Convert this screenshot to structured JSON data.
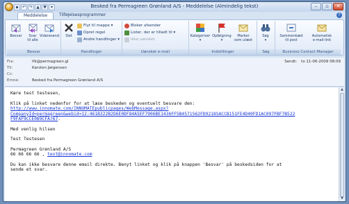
{
  "window": {
    "title": "Besked fra Permagreen Grønland A/S - Meddelelse (Almindelig tekst)",
    "minimize": "–",
    "maximize": "▫",
    "close": "✕"
  },
  "qat": {
    "save": "▪",
    "undo": "↶",
    "redo": "↷",
    "up": "▲",
    "down": "▼",
    "more": "▾"
  },
  "tabs": [
    {
      "label": "Meddelelse"
    },
    {
      "label": "Tilføjelsesprogrammer"
    }
  ],
  "ribbon": {
    "groups": [
      {
        "label": "Besvar",
        "buttons": [
          {
            "label": "Besvar"
          },
          {
            "label": "Svar\ntil alle"
          },
          {
            "label": "Videresend"
          }
        ]
      },
      {
        "label": "Handlinger",
        "big": {
          "label": "Slet"
        },
        "items": [
          {
            "label": "Flyt til mappe ▾"
          },
          {
            "label": "Opret regel"
          },
          {
            "label": "Andre handlinger ▾"
          }
        ]
      },
      {
        "label": "Uønsket e-mail",
        "items": [
          {
            "label": "Bloker afsender"
          },
          {
            "label": "Lister, der er tilladt til ▾"
          },
          {
            "label": "Ikke uønsket"
          }
        ]
      },
      {
        "label": "Indstillinger",
        "buttons": [
          {
            "label": "Kategoriser\n▾"
          },
          {
            "label": "Opfølgning\n▾"
          },
          {
            "label": "Marker\nsom ulæst"
          }
        ]
      },
      {
        "label": "Søg",
        "buttons": [
          {
            "label": "Søg\n▾"
          }
        ]
      },
      {
        "label": "Business Contact Manager",
        "buttons": [
          {
            "label": "Sammenkæd\ntil post"
          },
          {
            "label": "Automatisk\ne-mail-link"
          }
        ]
      }
    ]
  },
  "header": {
    "fields": [
      {
        "key": "Fra:",
        "value": "lfk@permagreen.gl"
      },
      {
        "key": "Til:",
        "value": "Karsten Jørgensen"
      },
      {
        "key": "Cc:",
        "value": ""
      },
      {
        "key": "Emne:",
        "value": "Besked fra Permagreen Grønland A/S"
      }
    ],
    "sent_label": "Sendt:",
    "sent_value": "to 11-06-2009 08:09"
  },
  "body": {
    "greeting": "Kære test testesen,",
    "intro": "Klik på linket nedenfor for at læse beskeden og eventuelt besvare den:",
    "link1": "http://www.innomate.com/INNOMATEpublicpages/WebMessage.aspx?",
    "link2": "CompanyId=permagreen&webid=12:461B322B2D6E0DF84A5EF7906BE1436FF5B4571562FD9218SACCB151FE4D40FD1AC097FBF7B522",
    "link3": "F9FAF9CCE0B9CFA767",
    "link3_tail": ".",
    "regards": "Med venlig hilsen",
    "name": "Test Testesen",
    "company": "Permagreen Grønland A/S",
    "phone": "66 66 66 66 , ",
    "email": "test@innomate.com",
    "note1": "Du kan ikke besvare denne email direkte. Benyt linket og klik på knappen 'Besvar' på beskedsiden for at",
    "note2": "sende et svar."
  },
  "colors": {
    "accent": "#1333d6",
    "titlebar": "#c4d6ee"
  }
}
